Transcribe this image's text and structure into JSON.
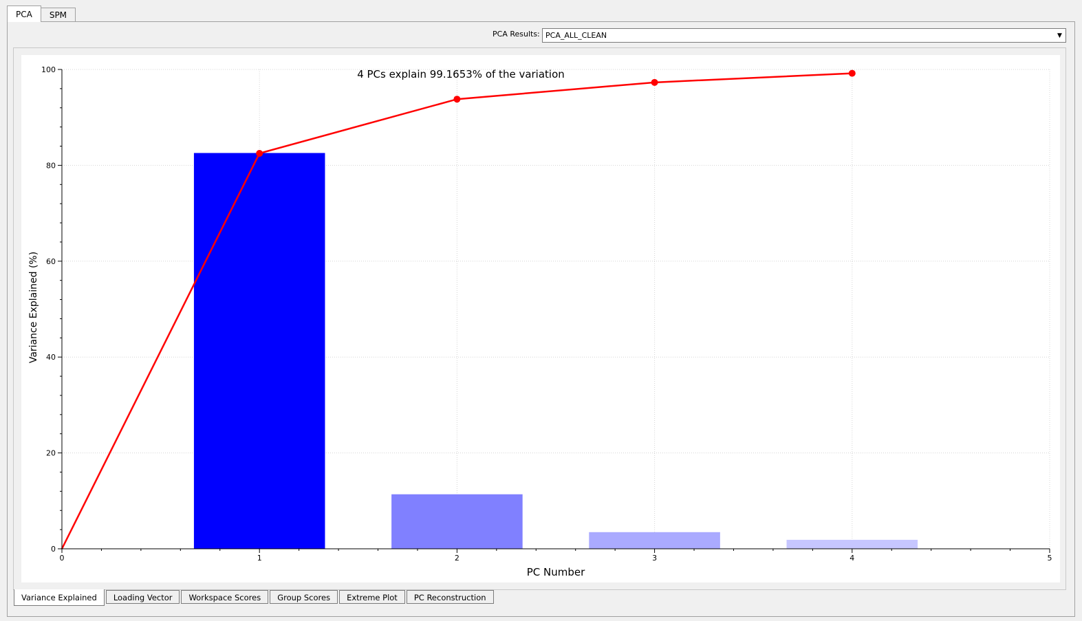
{
  "top_tabs": [
    {
      "label": "PCA",
      "active": true
    },
    {
      "label": "SPM",
      "active": false
    }
  ],
  "results": {
    "label": "PCA Results:",
    "value": "PCA_ALL_CLEAN"
  },
  "bottom_tabs": [
    {
      "label": "Variance Explained",
      "active": true
    },
    {
      "label": "Loading Vector",
      "active": false
    },
    {
      "label": "Workspace Scores",
      "active": false
    },
    {
      "label": "Group Scores",
      "active": false
    },
    {
      "label": "Extreme Plot",
      "active": false
    },
    {
      "label": "PC Reconstruction",
      "active": false
    }
  ],
  "chart_data": {
    "type": "bar",
    "title": "4 PCs explain 99.1653% of the variation",
    "xlabel": "PC Number",
    "ylabel": "Variance Explained (%)",
    "xlim": [
      0,
      5
    ],
    "ylim": [
      0,
      100
    ],
    "x_ticks": [
      0,
      1,
      2,
      3,
      4,
      5
    ],
    "y_ticks": [
      0,
      20,
      40,
      60,
      80,
      100
    ],
    "grid": true,
    "bars": {
      "x": [
        1,
        2,
        3,
        4
      ],
      "values": [
        82.5,
        11.3,
        3.4,
        1.8
      ],
      "colors": [
        "#0000ff",
        "#8080ff",
        "#aaaaff",
        "#c6c6ff"
      ]
    },
    "cumulative_line": {
      "x": [
        0,
        1,
        2,
        3,
        4
      ],
      "values": [
        0,
        82.5,
        93.8,
        97.3,
        99.2
      ],
      "color": "#ff0000"
    }
  }
}
